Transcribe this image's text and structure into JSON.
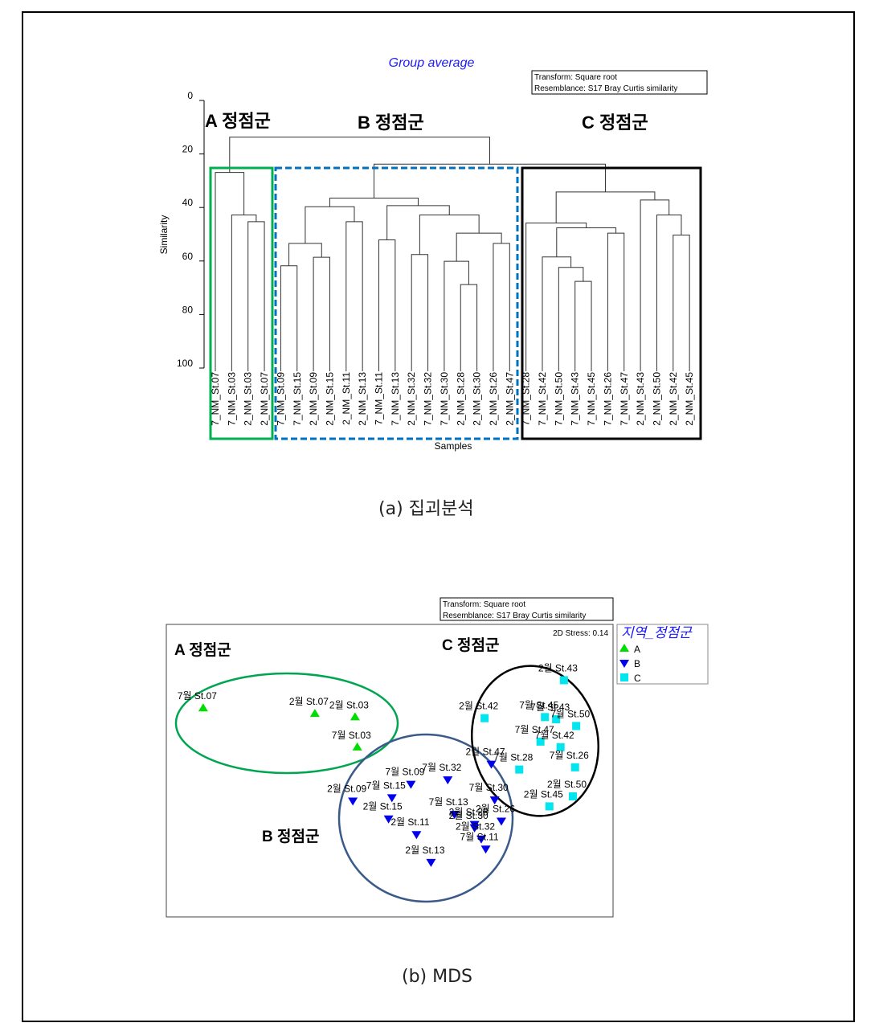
{
  "figure_a": {
    "caption": "(a) 집괴분석",
    "title": "Group average",
    "transform_box": [
      "Transform: Square root",
      "Resemblance: S17 Bray Curtis similarity"
    ],
    "group_labels": [
      "A 정점군",
      "B 정점군",
      "C 정점군"
    ]
  },
  "figure_b": {
    "caption": "(b) MDS",
    "transform_box": [
      "Transform: Square root",
      "Resemblance: S17 Bray Curtis similarity"
    ],
    "stress": "2D Stress: 0.14",
    "group_labels": [
      "A 정점군",
      "B 정점군",
      "C 정점군"
    ],
    "legend_title": "지역_정점군"
  },
  "colors": {
    "A": "#00dd00",
    "B": "#0000ee",
    "C": "#00e5ee",
    "box_A": "#00b050",
    "box_B": "#0070c0",
    "box_C": "#000000",
    "ellipse_B": "#3a5a8a",
    "title": "#1a1aff"
  },
  "chart_data": [
    {
      "type": "dendrogram",
      "title": "Group average",
      "xlabel": "Samples",
      "ylabel": "Similarity",
      "ylim": [
        0,
        100
      ],
      "yticks": [
        "0",
        "20",
        "40",
        "60",
        "80",
        "100"
      ],
      "leaves": [
        "7_NM_St.07",
        "7_NM_St.03",
        "2_NM_St.03",
        "2_NM_St.07",
        "7_NM_St.09",
        "7_NM_St.15",
        "2_NM_St.09",
        "2_NM_St.15",
        "2_NM_St.11",
        "2_NM_St.13",
        "7_NM_St.11",
        "7_NM_St.13",
        "2_NM_St.32",
        "7_NM_St.32",
        "7_NM_St.30",
        "2_NM_St.28",
        "2_NM_St.30",
        "2_NM_St.26",
        "2_NM_St.47",
        "7_NM_St.28",
        "7_NM_St.42",
        "7_NM_St.50",
        "7_NM_St.43",
        "7_NM_St.45",
        "7_NM_St.26",
        "7_NM_St.47",
        "2_NM_St.43",
        "2_NM_St.50",
        "2_NM_St.42",
        "2_NM_St.45"
      ],
      "groups": {
        "A": [
          0,
          3
        ],
        "B": [
          4,
          18
        ],
        "C": [
          19,
          29
        ]
      },
      "merges": [
        {
          "a": 2,
          "b": 3,
          "similarity": 45.3
        },
        {
          "a": 1,
          "b": "m0",
          "similarity": 42.8
        },
        {
          "a": 0,
          "b": "m1",
          "similarity": 26.9
        },
        {
          "a": 4,
          "b": 5,
          "similarity": 61.8
        },
        {
          "a": 6,
          "b": 7,
          "similarity": 58.6
        },
        {
          "a": "m3",
          "b": "m4",
          "similarity": 53.4
        },
        {
          "a": 8,
          "b": 9,
          "similarity": 45.3
        },
        {
          "a": "m5",
          "b": "m6",
          "similarity": 39.7
        },
        {
          "a": 10,
          "b": 11,
          "similarity": 52.1
        },
        {
          "a": 12,
          "b": 13,
          "similarity": 57.6
        },
        {
          "a": 15,
          "b": 16,
          "similarity": 68.8
        },
        {
          "a": 14,
          "b": "m10",
          "similarity": 60.1
        },
        {
          "a": 17,
          "b": 18,
          "similarity": 53.4
        },
        {
          "a": "m11",
          "b": "m12",
          "similarity": 49.6
        },
        {
          "a": "m9",
          "b": "m13",
          "similarity": 42.8
        },
        {
          "a": "m8",
          "b": "m14",
          "similarity": 39.3
        },
        {
          "a": "m7",
          "b": "m15",
          "similarity": 36.5
        },
        {
          "a": 22,
          "b": 23,
          "similarity": 67.6
        },
        {
          "a": 21,
          "b": "m17",
          "similarity": 62.4
        },
        {
          "a": 20,
          "b": "m18",
          "similarity": 58.5
        },
        {
          "a": 24,
          "b": 25,
          "similarity": 49.6
        },
        {
          "a": "m19",
          "b": "m20",
          "similarity": 47.6
        },
        {
          "a": 19,
          "b": "m21",
          "similarity": 45.8
        },
        {
          "a": 28,
          "b": 29,
          "similarity": 50.3
        },
        {
          "a": 27,
          "b": "m23",
          "similarity": 42.8
        },
        {
          "a": 26,
          "b": "m24",
          "similarity": 37.2
        },
        {
          "a": "m22",
          "b": "m25",
          "similarity": 34.2
        },
        {
          "a": "m16",
          "b": "m26",
          "similarity": 23.8
        },
        {
          "a": "m2",
          "b": "m27",
          "similarity": 13.7
        }
      ]
    },
    {
      "type": "scatter",
      "title": "",
      "stress": 0.14,
      "xlim": [
        -2,
        2
      ],
      "ylim": [
        -1.31,
        1.31
      ],
      "legend": {
        "title": "지역_정점군",
        "entries": [
          "A",
          "B",
          "C"
        ],
        "placement": "right-outside-top"
      },
      "series": [
        {
          "name": "A",
          "marker": "triangle-up",
          "points": [
            {
              "label": "7월 St.07",
              "x": -1.67,
              "y": 0.56
            },
            {
              "label": "2월 St.07",
              "x": -0.67,
              "y": 0.51
            },
            {
              "label": "2월 St.03",
              "x": -0.31,
              "y": 0.48
            },
            {
              "label": "7월 St.03",
              "x": -0.29,
              "y": 0.21
            }
          ]
        },
        {
          "name": "B",
          "marker": "triangle-down",
          "points": [
            {
              "label": "2월 St.09",
              "x": -0.33,
              "y": -0.27
            },
            {
              "label": "7월 St.09",
              "x": 0.19,
              "y": -0.12
            },
            {
              "label": "7월 St.15",
              "x": 0.02,
              "y": -0.24
            },
            {
              "label": "7월 St.32",
              "x": 0.52,
              "y": -0.08
            },
            {
              "label": "2월 St.15",
              "x": -0.01,
              "y": -0.43
            },
            {
              "label": "2월 St.11",
              "x": 0.24,
              "y": -0.57
            },
            {
              "label": "2월 St.13",
              "x": 0.37,
              "y": -0.82
            },
            {
              "label": "2월 St.47",
              "x": 0.91,
              "y": 0.06
            },
            {
              "label": "7월 St.30",
              "x": 0.94,
              "y": -0.26
            },
            {
              "label": "7월 St.13",
              "x": 0.58,
              "y": -0.39
            },
            {
              "label": "2월 St.28",
              "x": 0.76,
              "y": -0.48
            },
            {
              "label": "2월 St.30",
              "x": 0.76,
              "y": -0.51
            },
            {
              "label": "2월 St.32",
              "x": 0.82,
              "y": -0.61
            },
            {
              "label": "7월 St.11",
              "x": 0.86,
              "y": -0.7
            },
            {
              "label": "2월 St.26",
              "x": 1.0,
              "y": -0.45
            }
          ]
        },
        {
          "name": "C",
          "marker": "square",
          "points": [
            {
              "label": "2월 St.43",
              "x": 1.56,
              "y": 0.81
            },
            {
              "label": "2월 St.42",
              "x": 0.85,
              "y": 0.47
            },
            {
              "label": "7월 St.45",
              "x": 1.39,
              "y": 0.48
            },
            {
              "label": "7월 St.43",
              "x": 1.49,
              "y": 0.46
            },
            {
              "label": "7월 St.50",
              "x": 1.67,
              "y": 0.4
            },
            {
              "label": "7월 St.47",
              "x": 1.35,
              "y": 0.26
            },
            {
              "label": "7월 St.42",
              "x": 1.53,
              "y": 0.21
            },
            {
              "label": "7월 St.28",
              "x": 1.16,
              "y": 0.01
            },
            {
              "label": "7월 St.26",
              "x": 1.66,
              "y": 0.03
            },
            {
              "label": "2월 St.50",
              "x": 1.64,
              "y": -0.23
            },
            {
              "label": "2월 St.45",
              "x": 1.43,
              "y": -0.32
            }
          ]
        }
      ]
    }
  ]
}
